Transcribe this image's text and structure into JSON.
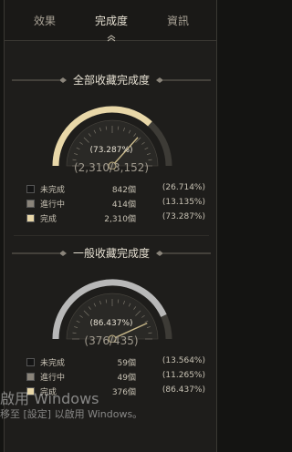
{
  "tabs": [
    {
      "label": "效果"
    },
    {
      "label": "完成度"
    },
    {
      "label": "資訊"
    }
  ],
  "active_tab": "完成度",
  "colors": {
    "complete": "#e8d7a8",
    "in_progress": "#8a847a",
    "incomplete": "#141414",
    "gauge_bg": "#3d3b36",
    "gold": "#c8b88a",
    "silver": "#b8b8b8"
  },
  "sections": [
    {
      "title": "全部收藏完成度",
      "percent_text": "73.287%",
      "count_text": "(2,310/3,152)",
      "legend": [
        {
          "label": "未完成",
          "value": "842個",
          "pct": "(26.714%)"
        },
        {
          "label": "進行中",
          "value": "414個",
          "pct": "(13.135%)"
        },
        {
          "label": "完成",
          "value": "2,310個",
          "pct": "(73.287%)"
        }
      ]
    },
    {
      "title": "一般收藏完成度",
      "percent_text": "86.437%",
      "count_text": "(376/435)",
      "legend": [
        {
          "label": "未完成",
          "value": "59個",
          "pct": "(13.564%)"
        },
        {
          "label": "進行中",
          "value": "49個",
          "pct": "(11.265%)"
        },
        {
          "label": "完成",
          "value": "376個",
          "pct": "(86.437%)"
        }
      ]
    }
  ],
  "chart_data": [
    {
      "type": "gauge",
      "title": "全部收藏完成度",
      "value": 73.287,
      "range": [
        0,
        100
      ],
      "segments": [
        {
          "name": "完成",
          "value": 73.287
        },
        {
          "name": "進行中",
          "value": 13.135
        },
        {
          "name": "未完成",
          "value": 26.714
        }
      ]
    },
    {
      "type": "gauge",
      "title": "一般收藏完成度",
      "value": 86.437,
      "range": [
        0,
        100
      ],
      "segments": [
        {
          "name": "完成",
          "value": 86.437
        },
        {
          "name": "進行中",
          "value": 11.265
        },
        {
          "name": "未完成",
          "value": 13.564
        }
      ]
    }
  ],
  "watermark": {
    "line1": "啟用 Windows",
    "line2": "移至 [設定] 以啟用 Windows。"
  }
}
